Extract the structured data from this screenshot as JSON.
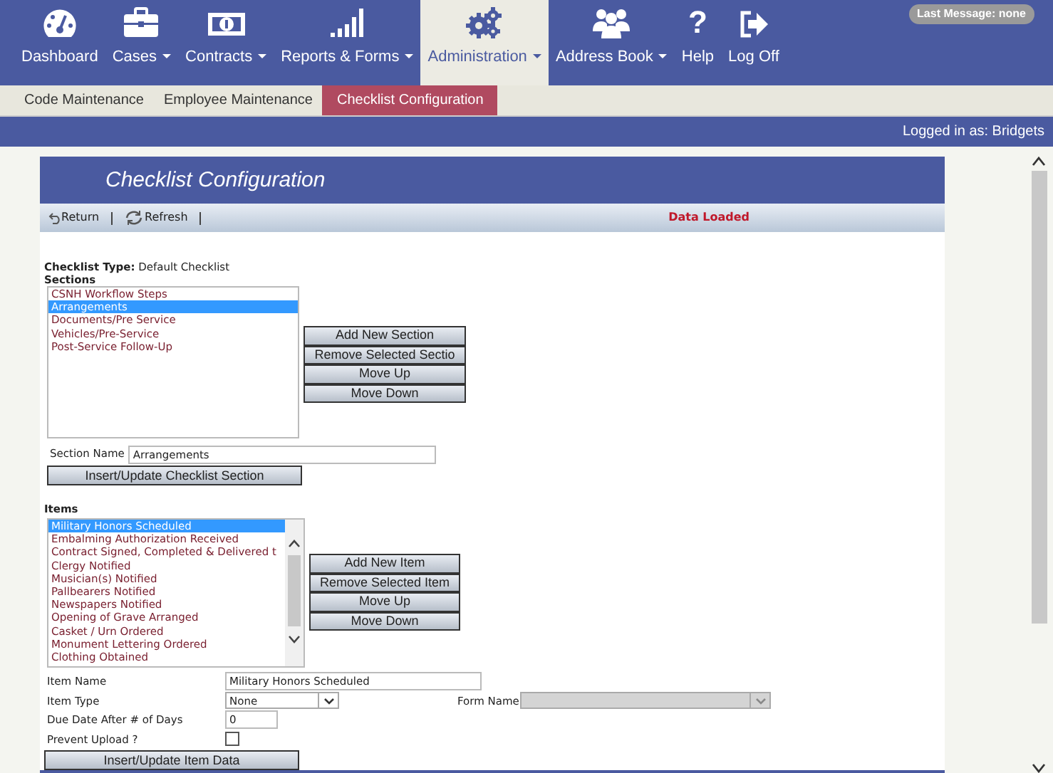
{
  "nav": {
    "items": [
      {
        "label": "Dashboard",
        "dropdown": false,
        "selected": false
      },
      {
        "label": "Cases",
        "dropdown": true,
        "selected": false
      },
      {
        "label": "Contracts",
        "dropdown": true,
        "selected": false
      },
      {
        "label": "Reports & Forms",
        "dropdown": true,
        "selected": false
      },
      {
        "label": "Administration",
        "dropdown": true,
        "selected": true
      },
      {
        "label": "Address Book",
        "dropdown": true,
        "selected": false
      },
      {
        "label": "Help",
        "glyph": "?",
        "dropdown": false,
        "selected": false
      },
      {
        "label": "Log Off",
        "dropdown": false,
        "selected": false
      }
    ],
    "badge": "Last Message: none"
  },
  "subnav": {
    "tabs": [
      {
        "label": "Code Maintenance",
        "selected": false
      },
      {
        "label": "Employee Maintenance",
        "selected": false
      },
      {
        "label": "Checklist Configuration",
        "selected": true
      }
    ]
  },
  "user_bar": "Logged in as: Bridgets",
  "panel": {
    "title": "Checklist Configuration",
    "toolbar": {
      "buttons": [
        "Return",
        "Refresh"
      ],
      "status": "Data Loaded"
    },
    "checklist_type": {
      "label": "Checklist Type:",
      "value": "Default Checklist"
    },
    "sections": {
      "heading": "Sections",
      "options": [
        {
          "label": "CSNH Workflow Steps",
          "selected": false
        },
        {
          "label": "Arrangements",
          "selected": true
        },
        {
          "label": "Documents/Pre Service",
          "selected": false
        },
        {
          "label": "Vehicles/Pre-Service",
          "selected": false
        },
        {
          "label": "Post-Service Follow-Up",
          "selected": false
        }
      ],
      "buttons": [
        "Add New Section",
        "Remove Selected Sectio",
        "Move Up",
        "Move Down"
      ],
      "name_label": "Section Name",
      "name_value": "Arrangements",
      "submit": "Insert/Update Checklist Section"
    },
    "items": {
      "heading": "Items",
      "options": [
        {
          "label": "Military Honors Scheduled",
          "selected": true
        },
        {
          "label": "Embalming Authorization Received",
          "selected": false
        },
        {
          "label": "Contract Signed, Completed & Delivered t",
          "selected": false
        },
        {
          "label": "Clergy Notified",
          "selected": false
        },
        {
          "label": "Musician(s) Notified",
          "selected": false
        },
        {
          "label": "Pallbearers Notified",
          "selected": false
        },
        {
          "label": "Newspapers Notified",
          "selected": false
        },
        {
          "label": "Opening of Grave Arranged",
          "selected": false
        },
        {
          "label": "Casket / Urn Ordered",
          "selected": false
        },
        {
          "label": "Monument Lettering Ordered",
          "selected": false
        },
        {
          "label": "Clothing Obtained",
          "selected": false
        }
      ],
      "buttons": [
        "Add New Item",
        "Remove Selected Item",
        "Move Up",
        "Move Down"
      ],
      "item_name": {
        "label": "Item Name",
        "value": "Military Honors Scheduled"
      },
      "item_type": {
        "label": "Item Type",
        "value": "None"
      },
      "form_name": {
        "label": "Form Name",
        "disabled": true
      },
      "due_days": {
        "label": "Due Date After # of Days",
        "value": "0"
      },
      "prevent_upload": {
        "label": "Prevent Upload ?",
        "checked": false
      },
      "submit": "Insert/Update Item Data"
    }
  }
}
